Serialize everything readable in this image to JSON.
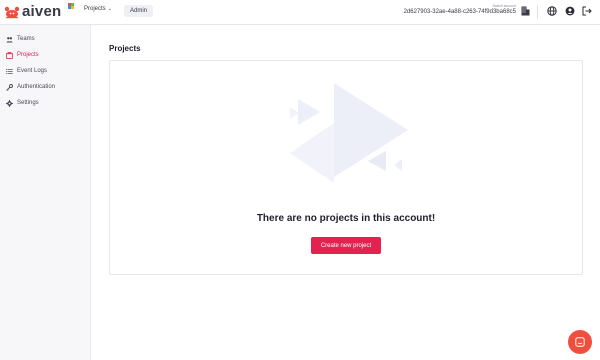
{
  "header": {
    "logo_text": "aiven",
    "nav": {
      "projects_label": "Projects",
      "admin_label": "Admin"
    },
    "account": {
      "switch_label": "Switch account",
      "id": "2d627903-32ae-4a88-c263-74f9d3ba68c5"
    },
    "icons": [
      "building-icon",
      "globe-icon",
      "user-icon",
      "logout-icon"
    ]
  },
  "sidebar": {
    "items": [
      {
        "label": "Teams",
        "icon": "team-icon",
        "active": false
      },
      {
        "label": "Projects",
        "icon": "projects-icon",
        "active": true
      },
      {
        "label": "Event Logs",
        "icon": "list-icon",
        "active": false
      },
      {
        "label": "Authentication",
        "icon": "key-icon",
        "active": false
      },
      {
        "label": "Settings",
        "icon": "gear-icon",
        "active": false
      }
    ]
  },
  "main": {
    "title": "Projects",
    "empty_message": "There are no projects in this account!",
    "create_button_label": "Create new project"
  },
  "colors": {
    "accent": "#e3234f",
    "sidebar_bg": "#f7f7fa",
    "illustration": "#eceef8",
    "chat": "#f04e3e"
  }
}
